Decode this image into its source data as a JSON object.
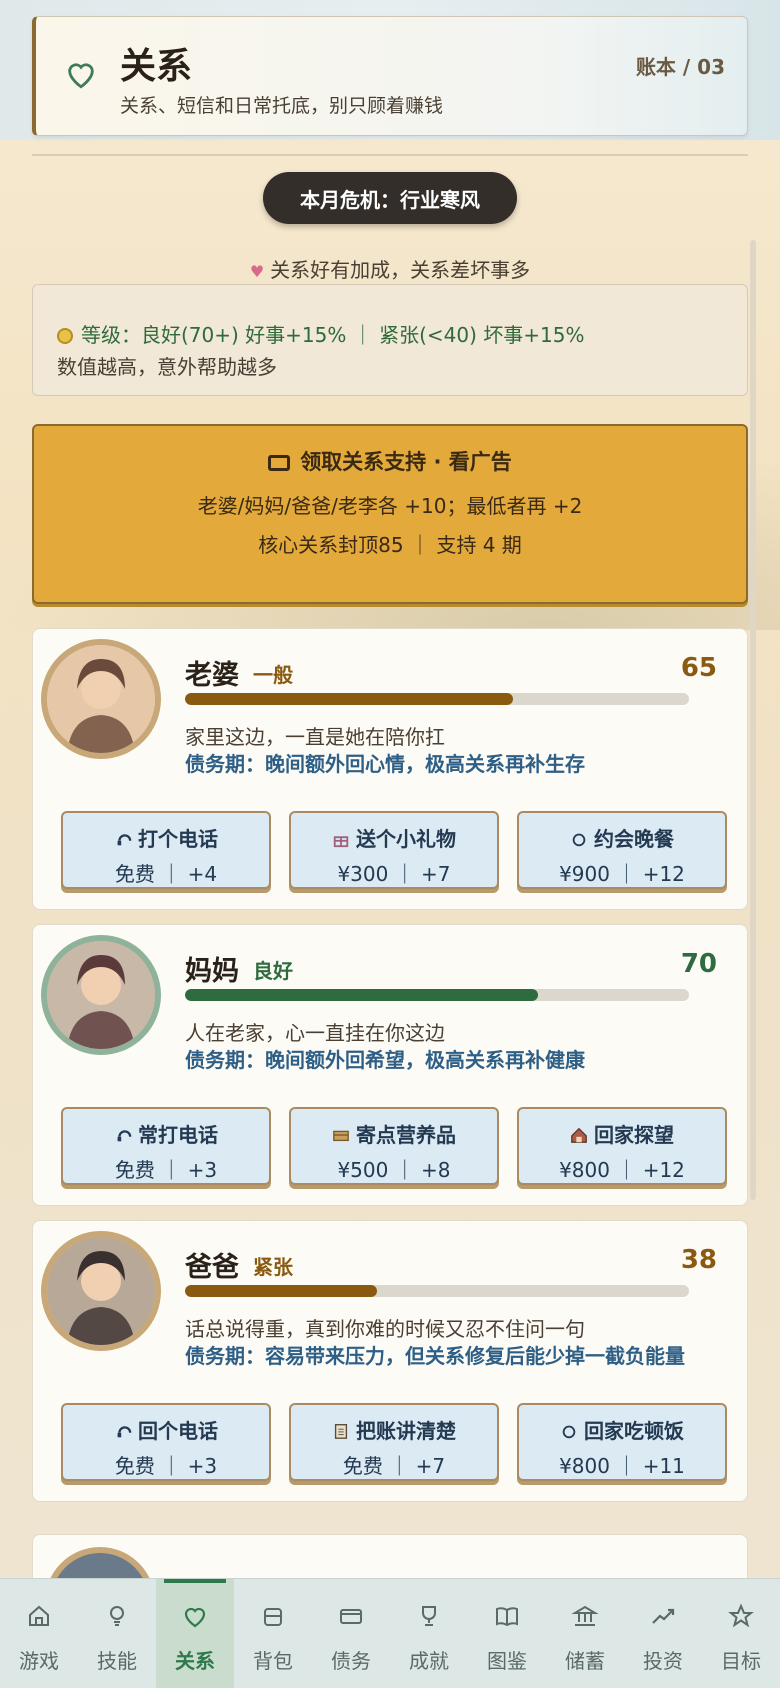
{
  "header": {
    "title": "关系",
    "subtitle": "关系、短信和日常托底，别只顾着赚钱",
    "ledger": "账本 / 03"
  },
  "crisis": {
    "label": "本月危机：行业寒风"
  },
  "hint": {
    "text": "关系好有加成，关系差坏事多"
  },
  "info": {
    "line1": "等级：良好(70+) 好事+15% ｜ 紧张(<40) 坏事+15%",
    "line2": "数值越高，意外帮助越多"
  },
  "ad": {
    "title": "领取关系支持 · 看广告",
    "line1": "老婆/妈妈/爸爸/老李各 +10；最低者再 +2",
    "line2": "核心关系封顶85 ｜ 支持 4 期"
  },
  "cards": [
    {
      "name": "老婆",
      "level": "一般",
      "score": "65",
      "progress": 0.65,
      "level_color": "#8a5a10",
      "bar_color": "#8a5a10",
      "desc": "家里这边，一直是她在陪你扛",
      "debt": "债务期：晚间额外回心情，极高关系再补生存",
      "actions": [
        {
          "icon": "phone-icon",
          "label": "打个电话",
          "sub": "免费 ｜ +4"
        },
        {
          "icon": "gift-icon",
          "label": "送个小礼物",
          "sub": "¥300 ｜ +7"
        },
        {
          "icon": "circle-icon",
          "label": "约会晚餐",
          "sub": "¥900 ｜ +12"
        }
      ]
    },
    {
      "name": "妈妈",
      "level": "良好",
      "score": "70",
      "progress": 0.7,
      "level_color": "#2e6b3e",
      "bar_color": "#2e6b3e",
      "desc": "人在老家，心一直挂在你这边",
      "debt": "债务期：晚间额外回希望，极高关系再补健康",
      "actions": [
        {
          "icon": "phone-icon",
          "label": "常打电话",
          "sub": "免费 ｜ +3"
        },
        {
          "icon": "box-icon",
          "label": "寄点营养品",
          "sub": "¥500 ｜ +8"
        },
        {
          "icon": "home-icon",
          "label": "回家探望",
          "sub": "¥800 ｜ +12"
        }
      ]
    },
    {
      "name": "爸爸",
      "level": "紧张",
      "score": "38",
      "progress": 0.38,
      "level_color": "#8a5a10",
      "bar_color": "#8a5a10",
      "desc": "话总说得重，真到你难的时候又忍不住问一句",
      "debt": "债务期：容易带来压力，但关系修复后能少掉一截负能量",
      "actions": [
        {
          "icon": "phone-icon",
          "label": "回个电话",
          "sub": "免费 ｜ +3"
        },
        {
          "icon": "ledger-icon",
          "label": "把账讲清楚",
          "sub": "免费 ｜ +7"
        },
        {
          "icon": "circle-icon",
          "label": "回家吃顿饭",
          "sub": "¥800 ｜ +11"
        }
      ]
    }
  ],
  "tabs": [
    {
      "label": "游戏",
      "icon": "home-icon"
    },
    {
      "label": "技能",
      "icon": "bulb-icon"
    },
    {
      "label": "关系",
      "icon": "heart-icon",
      "active": true
    },
    {
      "label": "背包",
      "icon": "bag-icon"
    },
    {
      "label": "债务",
      "icon": "card-icon"
    },
    {
      "label": "成就",
      "icon": "trophy-icon"
    },
    {
      "label": "图鉴",
      "icon": "book-icon"
    },
    {
      "label": "储蓄",
      "icon": "bank-icon"
    },
    {
      "label": "投资",
      "icon": "chart-icon"
    },
    {
      "label": "目标",
      "icon": "star-icon"
    }
  ]
}
